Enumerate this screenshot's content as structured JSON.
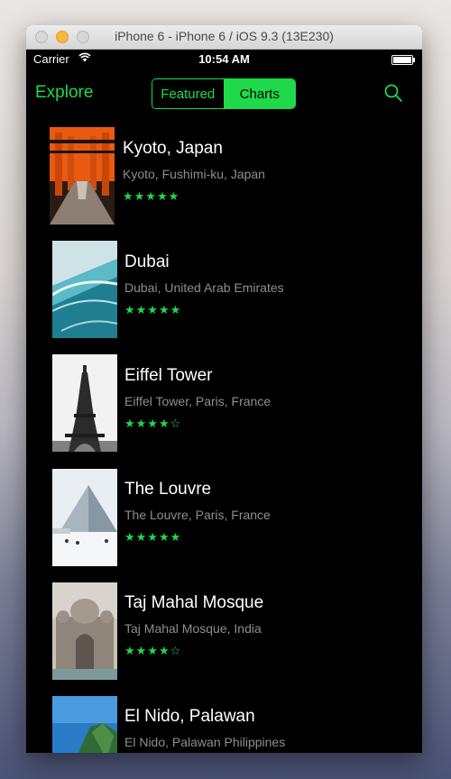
{
  "window": {
    "title": "iPhone 6 - iPhone 6 / iOS 9.3 (13E230)"
  },
  "status_bar": {
    "carrier": "Carrier",
    "time": "10:54 AM"
  },
  "nav": {
    "title": "Explore",
    "segments": [
      {
        "label": "Featured",
        "selected": false
      },
      {
        "label": "Charts",
        "selected": true
      }
    ],
    "search_icon": "search-icon"
  },
  "colors": {
    "accent": "#1ed94a",
    "background": "#000000",
    "subtitle": "#8e8e8e"
  },
  "places": [
    {
      "title": "Kyoto, Japan",
      "subtitle": "Kyoto, Fushimi-ku, Japan",
      "stars": "★★★★★",
      "rating": 5,
      "image": "torii-gates"
    },
    {
      "title": "Dubai",
      "subtitle": "Dubai, United Arab Emirates",
      "stars": "★★★★★",
      "rating": 5,
      "image": "coastline"
    },
    {
      "title": "Eiffel Tower",
      "subtitle": "Eiffel Tower, Paris, France",
      "stars": "★★★★☆",
      "rating": 4,
      "image": "eiffel-tower"
    },
    {
      "title": "The Louvre",
      "subtitle": "The Louvre, Paris, France",
      "stars": "★★★★★",
      "rating": 5,
      "image": "louvre-pyramid"
    },
    {
      "title": "Taj Mahal Mosque",
      "subtitle": "Taj Mahal Mosque, India",
      "stars": "★★★★☆",
      "rating": 4,
      "image": "taj-mahal"
    },
    {
      "title": "El Nido, Palawan",
      "subtitle": "El Nido, Palawan Philippines",
      "stars": "",
      "rating": null,
      "image": "island"
    }
  ]
}
